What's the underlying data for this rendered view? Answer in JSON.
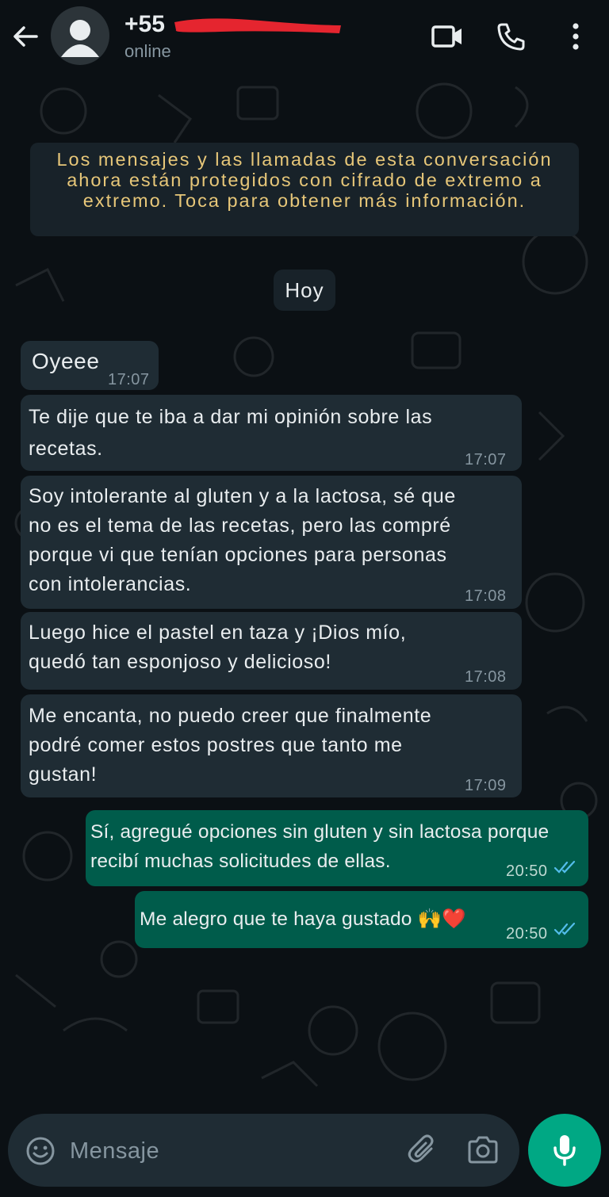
{
  "header": {
    "contact_name": "+55",
    "contact_status": "online"
  },
  "encryption_notice": "Los mensajes y las llamadas de esta conversación ahora están protegidos con cifrado de extremo a extremo. Toca para obtener más información.",
  "day_separator": "Hoy",
  "messages": [
    {
      "direction": "in",
      "lines": [
        "Oyeee"
      ],
      "time": "17:07"
    },
    {
      "direction": "in",
      "lines": [
        "Te dije que te iba a dar mi opinión sobre las",
        "recetas."
      ],
      "time": "17:07"
    },
    {
      "direction": "in",
      "lines": [
        "Soy intolerante al gluten y a la lactosa, sé que",
        "no es el tema de las recetas, pero las compré",
        "porque vi que tenían opciones para personas",
        "con intolerancias."
      ],
      "time": "17:08"
    },
    {
      "direction": "in",
      "lines": [
        "Luego hice el pastel en taza y ¡Dios mío,",
        "quedó tan esponjoso y delicioso!"
      ],
      "time": "17:08"
    },
    {
      "direction": "in",
      "lines": [
        "Me encanta, no puedo creer que finalmente",
        "podré comer estos postres que tanto me",
        "gustan!"
      ],
      "time": "17:09"
    },
    {
      "direction": "out",
      "lines": [
        "Sí, agregué opciones sin gluten y sin lactosa porque",
        "recibí muchas solicitudes de ellas."
      ],
      "time": "20:50",
      "read": true
    },
    {
      "direction": "out",
      "lines": [
        "Me alegro que te haya gustado 🙌❤️"
      ],
      "time": "20:50",
      "read": true
    }
  ],
  "composer": {
    "placeholder": "Mensaje"
  },
  "colors": {
    "background": "#0b1014",
    "incoming_bubble": "#1f2c34",
    "outgoing_bubble": "#005c4b",
    "notice_text": "#e7c779",
    "accent": "#00a884",
    "read_ticks": "#53bdeb"
  },
  "icons": [
    "back-arrow-icon",
    "avatar-icon",
    "video-call-icon",
    "phone-icon",
    "more-options-icon",
    "emoji-icon",
    "attach-icon",
    "camera-icon",
    "mic-icon",
    "double-check-icon"
  ]
}
